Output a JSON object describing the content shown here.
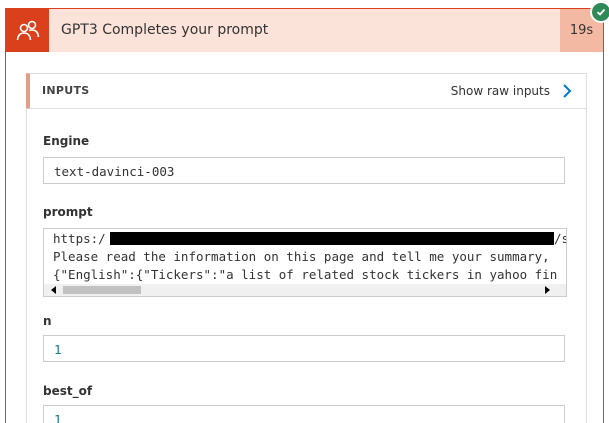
{
  "action": {
    "title": "GPT3 Completes your prompt",
    "duration": "19s",
    "status": "succeeded",
    "icon": "people-icon",
    "accent_color": "#d9401b",
    "header_bg": "#fbe3d9"
  },
  "inputs": {
    "label": "INPUTS",
    "raw_link": "Show raw inputs",
    "fields": {
      "engine": {
        "label": "Engine",
        "value": "text-davinci-003"
      },
      "prompt": {
        "label": "prompt",
        "line1_prefix": "https:/",
        "line1_suffix": "/s",
        "line2": "Please read the information on this page and tell me your summary,",
        "line3": "{\"English\":{\"Tickers\":\"a list of related stock tickers in yahoo fin"
      },
      "n": {
        "label": "n",
        "value": "1"
      },
      "best_of": {
        "label": "best_of",
        "value": "1"
      }
    }
  }
}
